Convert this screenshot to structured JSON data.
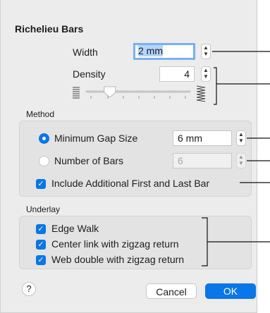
{
  "dialog_title": "Richelieu Bars",
  "width": {
    "label": "Width",
    "value": "2 mm"
  },
  "density": {
    "label": "Density",
    "value": "4",
    "slider_level": 0.2
  },
  "method": {
    "section_label": "Method",
    "minimum_gap": {
      "label": "Minimum Gap Size",
      "value": "6 mm",
      "selected": true
    },
    "number_of_bars": {
      "label": "Number of Bars",
      "value": "6",
      "selected": false
    },
    "include_first_last": {
      "label": "Include Additional First and Last Bar",
      "checked": true
    }
  },
  "underlay": {
    "section_label": "Underlay",
    "items": [
      {
        "label": "Edge Walk",
        "checked": true
      },
      {
        "label": "Center link with zigzag return",
        "checked": true
      },
      {
        "label": "Web double with zigzag return",
        "checked": true
      }
    ]
  },
  "buttons": {
    "help": "?",
    "cancel": "Cancel",
    "ok": "OK"
  },
  "colors": {
    "accent": "#0a76e8",
    "background": "#ececec",
    "group": "#e3e3e3"
  }
}
